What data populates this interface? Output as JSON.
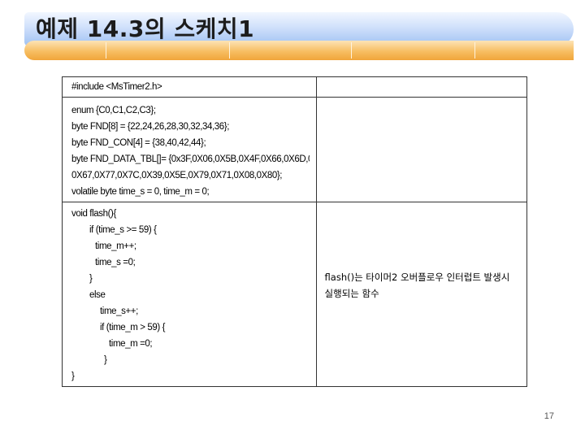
{
  "slide": {
    "title": "예제 14.3의 스케치1",
    "page_number": "17"
  },
  "table": {
    "row1": {
      "code": "#include <MsTimer2.h>",
      "note": ""
    },
    "row2": {
      "code_lines": [
        "enum {C0,C1,C2,C3};",
        "byte FND[8] = {22,24,26,28,30,32,34,36};",
        "byte FND_CON[4] = {38,40,42,44};",
        "byte FND_DATA_TBL[]= {0x3F,0X06,0X5B,0X4F,0X66,0X6D,0X7C,0X07,0X7F,",
        "0X67,0X77,0X7C,0X39,0X5E,0X79,0X71,0X08,0X80};",
        "volatile byte time_s = 0, time_m = 0;"
      ],
      "note": ""
    },
    "row3": {
      "code_lines": [
        "void flash(){",
        "if (time_s >= 59) {",
        "time_m++;",
        "time_s =0;",
        "}",
        "else",
        "time_s++;",
        "if (time_m > 59) {",
        "time_m =0;",
        "}",
        "}"
      ],
      "note": "flash()는 타이머2 오버플로우 인터럽트 발생시 실행되는 함수"
    }
  }
}
